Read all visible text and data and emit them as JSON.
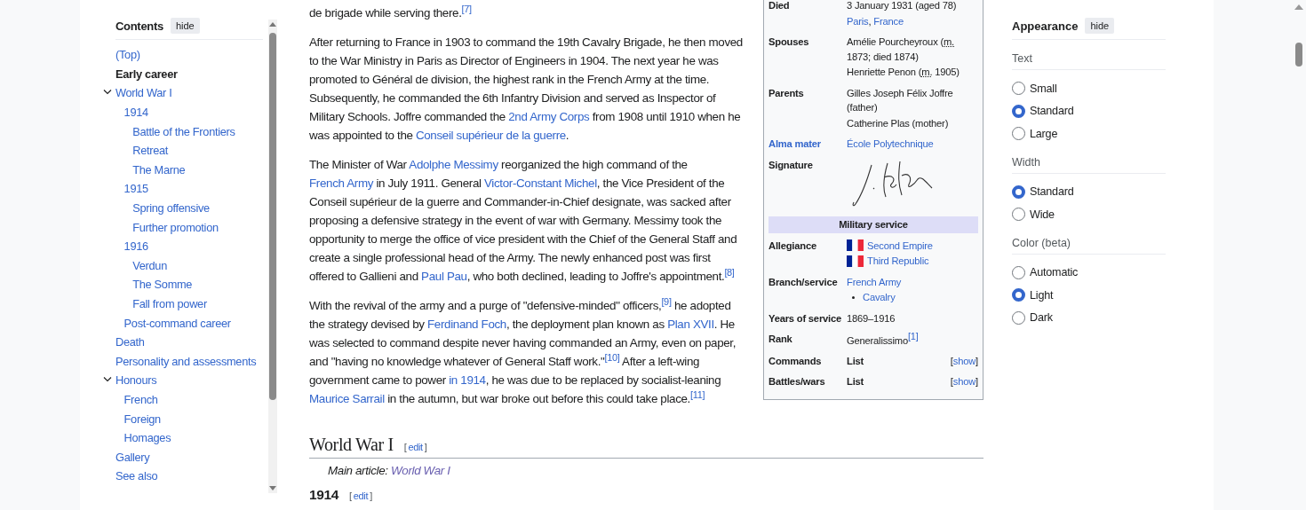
{
  "toc": {
    "title": "Contents",
    "hide": "hide",
    "items": [
      {
        "label": "(Top)",
        "selected": false
      },
      {
        "label": "Early career",
        "selected": true
      },
      {
        "label": "World War I",
        "selected": false,
        "expanded": true,
        "children": [
          {
            "label": "1914",
            "selected": false,
            "children": [
              {
                "label": "Battle of the Frontiers",
                "selected": false
              },
              {
                "label": "Retreat",
                "selected": false
              },
              {
                "label": "The Marne",
                "selected": false
              }
            ]
          },
          {
            "label": "1915",
            "selected": false,
            "children": [
              {
                "label": "Spring offensive",
                "selected": false
              },
              {
                "label": "Further promotion",
                "selected": false
              }
            ]
          },
          {
            "label": "1916",
            "selected": false,
            "children": [
              {
                "label": "Verdun",
                "selected": false
              },
              {
                "label": "The Somme",
                "selected": false
              },
              {
                "label": "Fall from power",
                "selected": false
              }
            ]
          },
          {
            "label": "Post-command career",
            "selected": false
          }
        ]
      },
      {
        "label": "Death",
        "selected": false
      },
      {
        "label": "Personality and assessments",
        "selected": false
      },
      {
        "label": "Honours",
        "selected": false,
        "expanded": true,
        "children": [
          {
            "label": "French",
            "selected": false
          },
          {
            "label": "Foreign",
            "selected": false
          },
          {
            "label": "Homages",
            "selected": false
          }
        ]
      },
      {
        "label": "Gallery",
        "selected": false
      },
      {
        "label": "See also",
        "selected": false
      }
    ]
  },
  "article": {
    "paragraphs": [
      {
        "segments": [
          {
            "kind": "text",
            "text": "de brigade while serving there."
          },
          {
            "kind": "ref",
            "text": "[7]"
          }
        ]
      },
      {
        "segments": [
          {
            "kind": "text",
            "text": "After returning to France in 1903 to command the 19th Cavalry Brigade, he then moved to the War Ministry in Paris as Director of Engineers in 1904. The next year he was promoted to Général de division, the highest rank in the French Army at the time. Subsequently, he commanded the 6th Infantry Division and served as Inspector of Military Schools. Joffre commanded the "
          },
          {
            "kind": "link",
            "text": "2nd Army Corps"
          },
          {
            "kind": "text",
            "text": " from 1908 until 1910 when he was appointed to the "
          },
          {
            "kind": "link",
            "text": "Conseil supérieur de la guerre"
          },
          {
            "kind": "text",
            "text": "."
          }
        ]
      },
      {
        "segments": [
          {
            "kind": "text",
            "text": "The Minister of War "
          },
          {
            "kind": "link",
            "text": "Adolphe Messimy"
          },
          {
            "kind": "text",
            "text": " reorganized the high command of the "
          },
          {
            "kind": "link",
            "text": "French Army"
          },
          {
            "kind": "text",
            "text": " in July 1911. General "
          },
          {
            "kind": "link",
            "text": "Victor-Constant Michel"
          },
          {
            "kind": "text",
            "text": ", the Vice President of the Conseil supérieur de la guerre and Commander-in-Chief designate, was sacked after proposing a defensive strategy in the event of war with Germany. Messimy took the opportunity to merge the office of vice president with the Chief of the General Staff and create a single professional head of the Army. The newly enhanced post was first offered to Gallieni and "
          },
          {
            "kind": "link",
            "text": "Paul Pau"
          },
          {
            "kind": "text",
            "text": ", who both declined, leading to Joffre's appointment."
          },
          {
            "kind": "ref",
            "text": "[8]"
          }
        ]
      },
      {
        "segments": [
          {
            "kind": "text",
            "text": "With the revival of the army and a purge of \"defensive-minded\" officers,"
          },
          {
            "kind": "ref",
            "text": "[9]"
          },
          {
            "kind": "text",
            "text": " he adopted the strategy devised by "
          },
          {
            "kind": "link",
            "text": "Ferdinand Foch"
          },
          {
            "kind": "text",
            "text": ", the deployment plan known as "
          },
          {
            "kind": "link",
            "text": "Plan XVII"
          },
          {
            "kind": "text",
            "text": ". He was selected to command despite never having commanded an Army, even on paper, and \"having no knowledge whatever of General Staff work.\""
          },
          {
            "kind": "ref",
            "text": "[10]"
          },
          {
            "kind": "text",
            "text": " After a left-wing government came to power "
          },
          {
            "kind": "link",
            "text": "in 1914"
          },
          {
            "kind": "text",
            "text": ", he was due to be replaced by socialist-leaning "
          },
          {
            "kind": "link",
            "text": "Maurice Sarrail"
          },
          {
            "kind": "text",
            "text": " in the autumn, but war broke out before this could take place."
          },
          {
            "kind": "ref",
            "text": "[11]"
          }
        ]
      }
    ],
    "heading": {
      "text": "World War I",
      "edit": {
        "before": "[",
        "text": "edit",
        "after": "]"
      }
    },
    "hatnote": {
      "prefix": "Main article: ",
      "link": "World War I"
    },
    "subheading": {
      "text": "1914",
      "edit": {
        "before": "[",
        "text": "edit",
        "after": "]"
      }
    }
  },
  "infobox": {
    "rows": [
      {
        "kind": "field",
        "label": "Died",
        "lines": [
          {
            "kind": "plain",
            "parts": [
              {
                "kind": "text",
                "text": "3 January 1931 (aged 78)"
              }
            ]
          },
          {
            "kind": "plain",
            "parts": [
              {
                "kind": "link",
                "text": "Paris"
              },
              {
                "kind": "text",
                "text": ", "
              },
              {
                "kind": "link",
                "text": "France"
              }
            ]
          }
        ]
      },
      {
        "kind": "field",
        "label": "Spouses",
        "lines": [
          {
            "kind": "plain",
            "parts": [
              {
                "kind": "text",
                "text": "Amélie Pourcheyroux ("
              },
              {
                "kind": "abbr",
                "text": "m."
              },
              {
                "kind": "text",
                "text": " 1873; died 1874)"
              }
            ]
          },
          {
            "kind": "plain",
            "parts": [
              {
                "kind": "text",
                "text": "Henriette Penon ("
              },
              {
                "kind": "abbr",
                "text": "m."
              },
              {
                "kind": "text",
                "text": " 1905)"
              }
            ]
          }
        ]
      },
      {
        "kind": "field",
        "label": "Parents",
        "lines": [
          {
            "kind": "plain",
            "parts": [
              {
                "kind": "text",
                "text": "Gilles Joseph Félix Joffre (father)"
              }
            ]
          },
          {
            "kind": "plain",
            "parts": [
              {
                "kind": "text",
                "text": "Catherine Plas (mother)"
              }
            ]
          }
        ]
      },
      {
        "kind": "field",
        "label": "Alma mater",
        "label_link": true,
        "lines": [
          {
            "kind": "plain",
            "parts": [
              {
                "kind": "link",
                "text": "École Polytechnique"
              }
            ]
          }
        ]
      },
      {
        "kind": "signature",
        "label": "Signature"
      },
      {
        "kind": "header",
        "label": "Military service"
      },
      {
        "kind": "field",
        "label": "Allegiance",
        "lines": [
          {
            "kind": "flag",
            "parts": [
              {
                "kind": "link",
                "text": "Second Empire"
              }
            ]
          },
          {
            "kind": "flag",
            "parts": [
              {
                "kind": "link",
                "text": "Third Republic"
              }
            ]
          }
        ]
      },
      {
        "kind": "field",
        "label": "Branch/service",
        "lines": [
          {
            "kind": "plain",
            "parts": [
              {
                "kind": "link",
                "text": "French Army"
              }
            ]
          },
          {
            "kind": "bullet",
            "parts": [
              {
                "kind": "link",
                "text": "Cavalry"
              }
            ]
          }
        ]
      },
      {
        "kind": "field",
        "label": "Years of service",
        "lines": [
          {
            "kind": "plain",
            "parts": [
              {
                "kind": "text",
                "text": "1869–1916"
              }
            ]
          }
        ]
      },
      {
        "kind": "field",
        "label": "Rank",
        "lines": [
          {
            "kind": "plain",
            "parts": [
              {
                "kind": "text",
                "text": "Generalissimo"
              },
              {
                "kind": "ref",
                "text": "[1]"
              }
            ]
          }
        ]
      },
      {
        "kind": "collapsible",
        "label": "Commands",
        "value": "List",
        "toggle": {
          "before": "[",
          "text": "show",
          "after": "]"
        }
      },
      {
        "kind": "collapsible",
        "label": "Battles/wars",
        "value": "List",
        "toggle": {
          "before": "[",
          "text": "show",
          "after": "]"
        }
      }
    ]
  },
  "appearance": {
    "title": "Appearance",
    "hide": "hide",
    "groups": [
      {
        "title": "Text",
        "options": [
          {
            "label": "Small",
            "selected": false
          },
          {
            "label": "Standard",
            "selected": true
          },
          {
            "label": "Large",
            "selected": false
          }
        ]
      },
      {
        "title": "Width",
        "options": [
          {
            "label": "Standard",
            "selected": true
          },
          {
            "label": "Wide",
            "selected": false
          }
        ]
      },
      {
        "title": "Color (beta)",
        "options": [
          {
            "label": "Automatic",
            "selected": false
          },
          {
            "label": "Light",
            "selected": true
          },
          {
            "label": "Dark",
            "selected": false
          }
        ]
      }
    ]
  }
}
